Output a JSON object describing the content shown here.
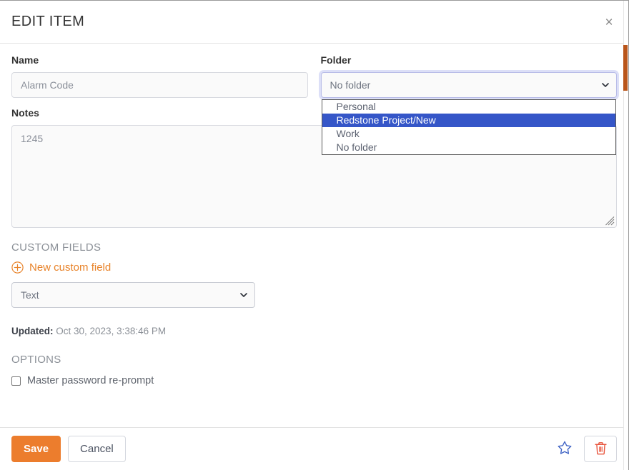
{
  "header": {
    "title": "EDIT ITEM",
    "close_label": "×",
    "close_icon": "close-icon"
  },
  "form": {
    "name": {
      "label": "Name",
      "value": "Alarm Code",
      "placeholder": "Alarm Code"
    },
    "folder": {
      "label": "Folder",
      "selected": "No folder",
      "open": true,
      "options": [
        {
          "label": "Personal",
          "selected": false
        },
        {
          "label": "Redstone Project/New",
          "selected": true
        },
        {
          "label": "Work",
          "selected": false
        },
        {
          "label": "No folder",
          "selected": false
        }
      ]
    },
    "notes": {
      "label": "Notes",
      "value": "1245",
      "placeholder": "1245"
    }
  },
  "custom_fields": {
    "heading": "CUSTOM FIELDS",
    "new_field_link": "New custom field",
    "new_field_icon": "plus-circle-icon",
    "type_select": {
      "selected": "Text",
      "options": [
        "Text"
      ]
    }
  },
  "meta": {
    "updated_label": "Updated:",
    "updated_value": "Oct 30, 2023, 3:38:46 PM"
  },
  "options": {
    "heading": "OPTIONS",
    "master_password_reprompt": {
      "label": "Master password re-prompt",
      "checked": false
    }
  },
  "footer": {
    "save_label": "Save",
    "cancel_label": "Cancel",
    "favorite_icon": "star-icon",
    "delete_icon": "trash-icon"
  },
  "colors": {
    "accent_orange": "#ec7d2d",
    "link_orange": "#e8832a",
    "highlight_blue": "#3556c8",
    "star_blue": "#3e62c4",
    "trash_red": "#e8553d",
    "focus_ring": "#b9bde8",
    "scrollbar_thumb": "#b9551a"
  }
}
